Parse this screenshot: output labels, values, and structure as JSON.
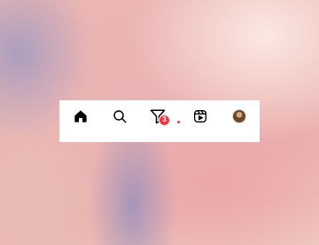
{
  "colors": {
    "bar_background": "#ffffff",
    "icon": "#000000",
    "badge": "#ff3040",
    "badge_text": "#ffffff"
  },
  "tab_bar": {
    "tabs": [
      {
        "name": "home",
        "icon": "home-icon",
        "active": true
      },
      {
        "name": "search",
        "icon": "search-icon",
        "active": false
      },
      {
        "name": "activity",
        "icon": "filter-heart-icon",
        "active": false,
        "badge": "3"
      },
      {
        "name": "reels",
        "icon": "reels-icon",
        "active": false
      },
      {
        "name": "profile",
        "icon": "avatar",
        "active": false,
        "has_notification_dot": true
      }
    ]
  }
}
